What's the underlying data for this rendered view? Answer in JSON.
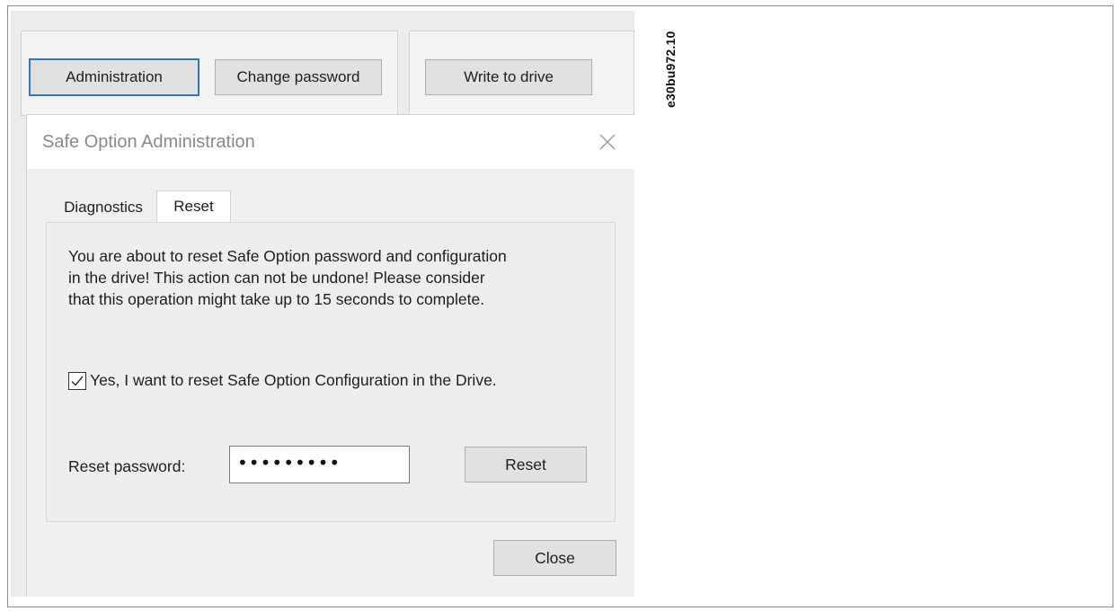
{
  "toolbar": {
    "administration_label": "Administration",
    "change_password_label": "Change password",
    "write_to_drive_label": "Write to drive"
  },
  "figure_id": "e30bu972.10",
  "dialog": {
    "title": "Safe Option Administration",
    "close_icon": "close-icon",
    "tabs": [
      {
        "label": "Diagnostics",
        "active": false
      },
      {
        "label": "Reset",
        "active": true
      }
    ],
    "reset_tab": {
      "warning_lines": [
        "You are about to reset Safe Option password and configuration",
        "in the drive! This action can not be undone! Please consider",
        "that this operation might take up to 15 seconds to complete."
      ],
      "confirm_checked": true,
      "confirm_label": "Yes, I want to reset Safe Option Configuration in the Drive.",
      "password_label": "Reset password:",
      "password_value": "•••••••••",
      "reset_button_label": "Reset"
    },
    "close_button_label": "Close"
  },
  "colors": {
    "focus_border": "#2b79c2",
    "button_face": "#e1e1e1",
    "dialog_bg": "#f0f0f0"
  }
}
